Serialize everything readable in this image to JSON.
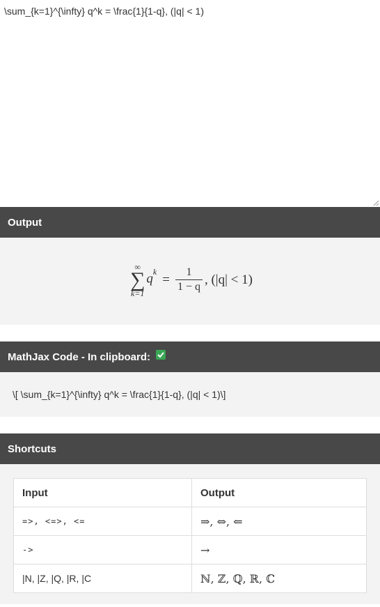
{
  "input": {
    "value": "\\sum_{k=1}^{\\infty} q^k = \\frac{1}{1-q}, (|q| < 1)"
  },
  "output": {
    "header": "Output",
    "formula": {
      "sum_sup": "∞",
      "sum_symbol": "∑",
      "sum_sub": "k=1",
      "term_base": "q",
      "term_exp": "k",
      "equals": "=",
      "numerator": "1",
      "denominator": "1 − q",
      "tail": ", (|q| < 1)"
    }
  },
  "mathjax": {
    "header": "MathJax Code - In clipboard:",
    "code": "\\[ \\sum_{k=1}^{\\infty} q^k = \\frac{1}{1-q}, (|q| < 1)\\]",
    "check_color": "#3aa655"
  },
  "shortcuts": {
    "header": "Shortcuts",
    "columns": [
      "Input",
      "Output"
    ],
    "rows": [
      {
        "input": "=>, <=>, <=",
        "output": "⇒, ⇔, ⇐"
      },
      {
        "input": "->",
        "output": "→"
      },
      {
        "input": "|N, |Z, |Q, |R, |C",
        "output": "ℕ, ℤ, ℚ, ℝ, ℂ"
      }
    ]
  },
  "colors": {
    "header_bg": "#484848",
    "body_bg": "#f3f3f3"
  }
}
